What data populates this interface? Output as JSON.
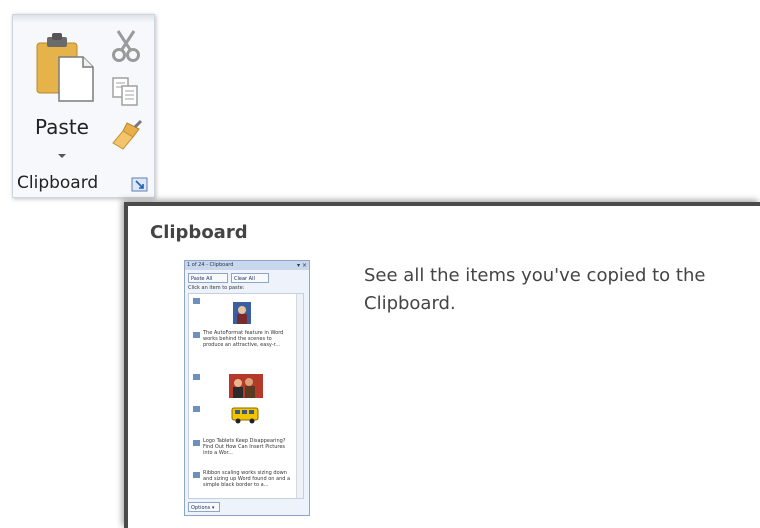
{
  "ribbon": {
    "paste_label": "Paste",
    "group_label": "Clipboard",
    "icons": {
      "paste": "paste-clipboard-icon",
      "cut": "scissors-icon",
      "copy": "copy-icon",
      "format_painter": "paintbrush-icon",
      "launcher": "dialog-launcher-icon"
    }
  },
  "tooltip": {
    "title": "Clipboard",
    "description": "See all the items you've copied to the Clipboard."
  },
  "preview": {
    "header": "1 of 24 - Clipboard",
    "paste_all": "Paste All",
    "clear_all": "Clear All",
    "hint": "Click an item to paste:",
    "items": [
      "The AutoFormat feature in Word works behind the scenes to produce an attractive, easy-r...",
      "Logo Tablets Keep Disappearing? Find Out How Can Insert Pictures into a Wor...",
      "Ribbon scaling works sizing down and sizing up Word found on and a simple black border to a..."
    ],
    "options": "Options ▾"
  },
  "colors": {
    "accent": "#1f5fb4",
    "clipboard_yellow": "#e6b34a",
    "border_dark": "#4a4a4a",
    "text": "#444444"
  }
}
